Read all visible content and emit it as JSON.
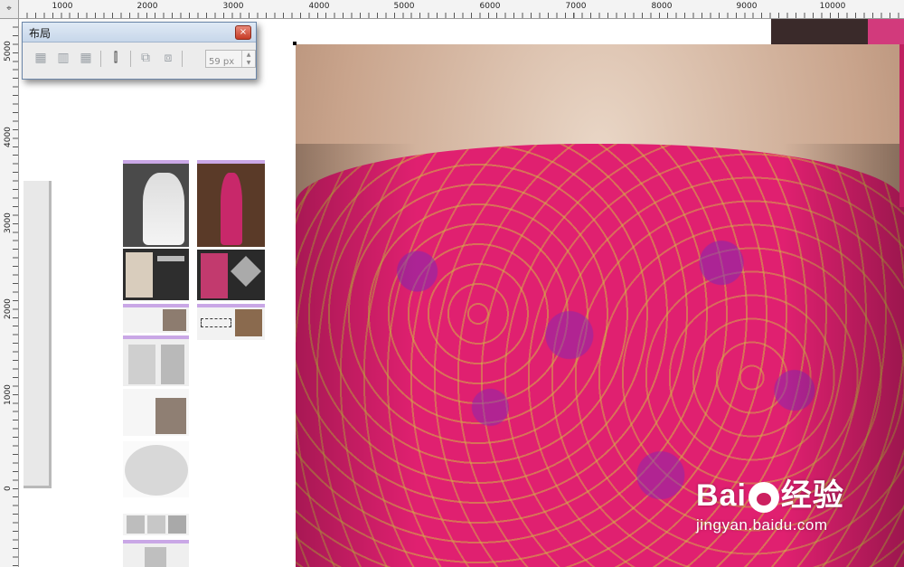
{
  "ruler_top": {
    "labels": [
      "1000",
      "2000",
      "3000",
      "4000",
      "5000",
      "6000",
      "7000",
      "8000",
      "9000",
      "10000"
    ]
  },
  "ruler_left": {
    "labels": [
      "5000",
      "4000",
      "3000",
      "2000",
      "1000",
      "0"
    ]
  },
  "layout_panel": {
    "title": "布局",
    "close_glyph": "×",
    "size_value": "59 px",
    "tools": [
      "grid-layout-icon",
      "columns-icon",
      "rows-icon",
      "equal-spacing-icon",
      "align-left-icon",
      "align-right-icon"
    ]
  },
  "watermark": {
    "brand": "Bai",
    "brand2": "经验",
    "url": "jingyan.baidu.com"
  },
  "colors": {
    "dress": "#e02070",
    "sequin": "#8228b4",
    "thread": "#d2b446",
    "panel_border": "#6b86a8"
  }
}
